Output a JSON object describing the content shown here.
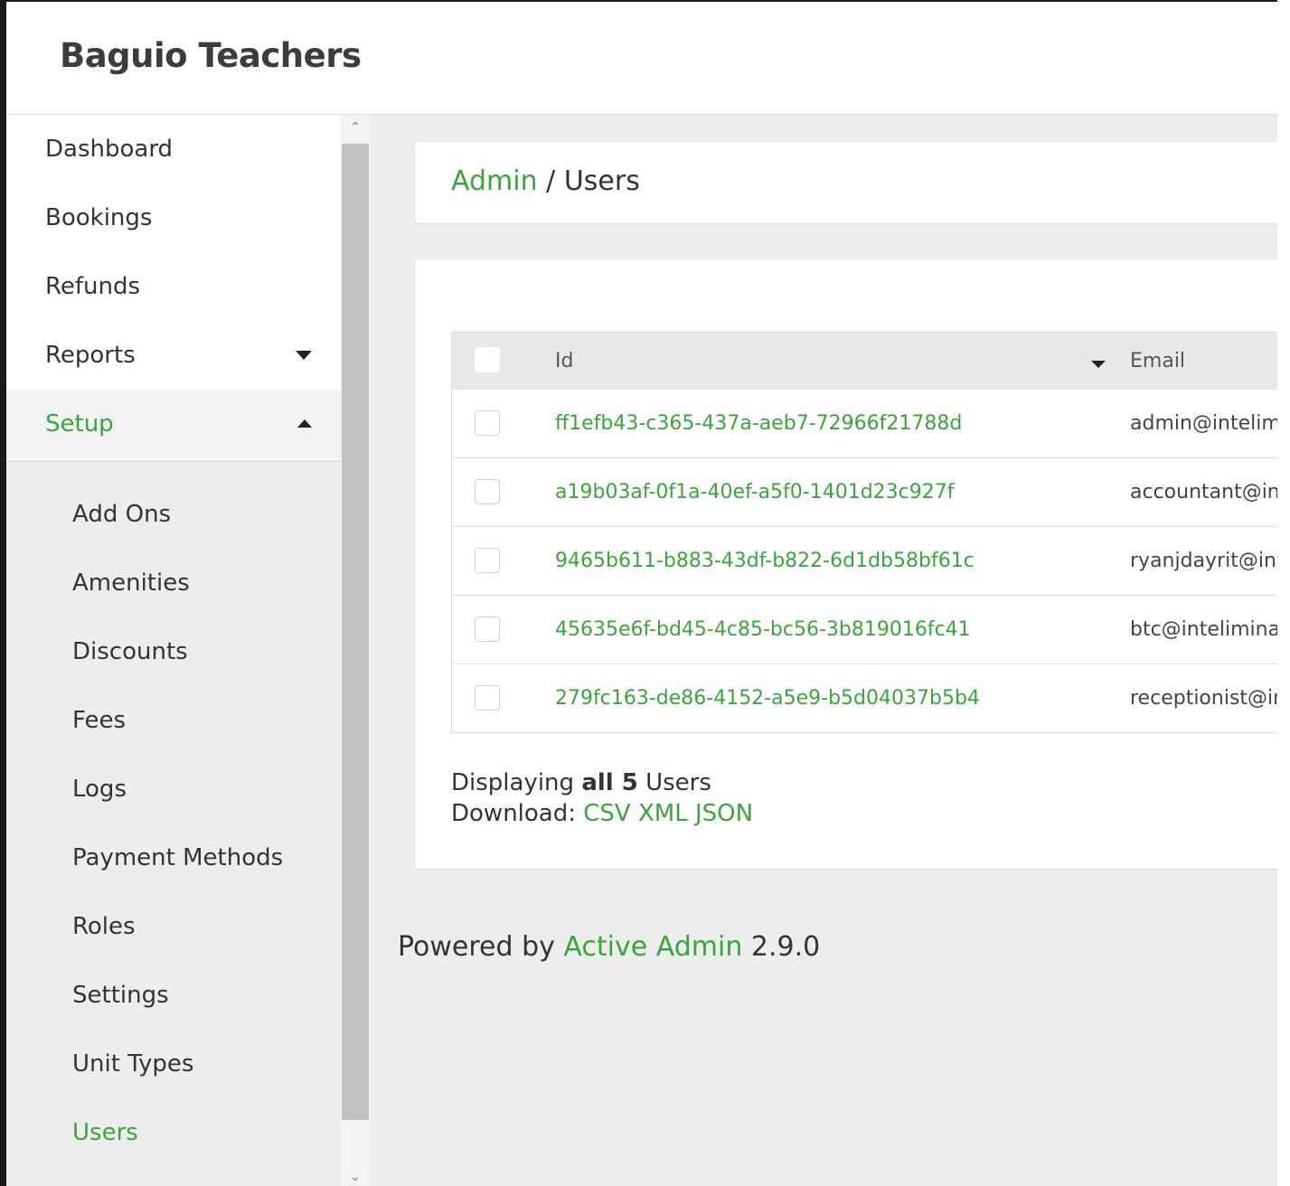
{
  "header": {
    "title": "Baguio Teachers"
  },
  "sidebar": {
    "items": [
      {
        "label": "Dashboard"
      },
      {
        "label": "Bookings"
      },
      {
        "label": "Refunds"
      },
      {
        "label": "Reports"
      },
      {
        "label": "Setup"
      }
    ],
    "submenu": [
      {
        "label": "Add Ons"
      },
      {
        "label": "Amenities"
      },
      {
        "label": "Discounts"
      },
      {
        "label": "Fees"
      },
      {
        "label": "Logs"
      },
      {
        "label": "Payment Methods"
      },
      {
        "label": "Roles"
      },
      {
        "label": "Settings"
      },
      {
        "label": "Unit Types"
      },
      {
        "label": "Users"
      }
    ]
  },
  "breadcrumb": {
    "parent": "Admin",
    "separator": " / ",
    "current": "Users"
  },
  "table": {
    "columns": {
      "id": "Id",
      "email": "Email"
    },
    "rows": [
      {
        "id": "ff1efb43-c365-437a-aeb7-72966f21788d",
        "email": "admin@intelimi"
      },
      {
        "id": "a19b03af-0f1a-40ef-a5f0-1401d23c927f",
        "email": "accountant@int"
      },
      {
        "id": "9465b611-b883-43df-b822-6d1db58bf61c",
        "email": "ryanjdayrit@int"
      },
      {
        "id": "45635e6f-bd45-4c85-bc56-3b819016fc41",
        "email": "btc@intelimina."
      },
      {
        "id": "279fc163-de86-4152-a5e9-b5d04037b5b4",
        "email": "receptionist@in"
      }
    ]
  },
  "footer": {
    "displaying_prefix": "Displaying ",
    "displaying_bold": "all 5",
    "displaying_suffix": " Users",
    "download_label": "Download: ",
    "formats": [
      "CSV",
      "XML",
      "JSON"
    ]
  },
  "powered": {
    "prefix": "Powered by ",
    "link": "Active Admin",
    "version": " 2.9.0"
  },
  "colors": {
    "accent": "#3aa63a",
    "background": "#ededed"
  }
}
